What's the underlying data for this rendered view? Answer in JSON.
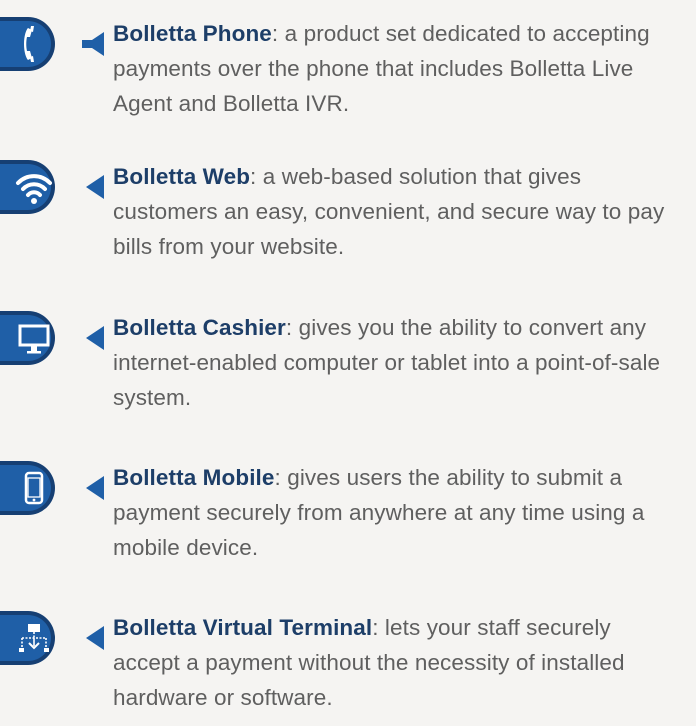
{
  "colors": {
    "background": "#f5f4f2",
    "icon_fill": "#1f5fa7",
    "icon_ring": "#163f73",
    "arrow": "#1f5fa7",
    "title": "#1d3e68",
    "body_text": "#5f5f5f"
  },
  "items": [
    {
      "icon": "phone-icon",
      "title": "Bolletta Phone",
      "desc": ": a product set dedicated to accepting payments over the phone that includes Bolletta Live Agent and Bolletta IVR."
    },
    {
      "icon": "wifi-icon",
      "title": "Bolletta Web",
      "desc": ": a web-based solution that gives customers an easy, convenient, and secure way to pay bills from your website."
    },
    {
      "icon": "monitor-icon",
      "title": "Bolletta Cashier",
      "desc": ": gives you the ability to convert any internet-enabled computer or tablet into a point-of-sale system."
    },
    {
      "icon": "smartphone-icon",
      "title": "Bolletta Mobile",
      "desc": ": gives users the ability to submit a payment securely from anywhere at any time using a mobile device."
    },
    {
      "icon": "network-terminal-icon",
      "title": "Bolletta Virtual Terminal",
      "desc": ": lets your staff securely accept a payment without the necessity of installed hardware or software."
    }
  ]
}
